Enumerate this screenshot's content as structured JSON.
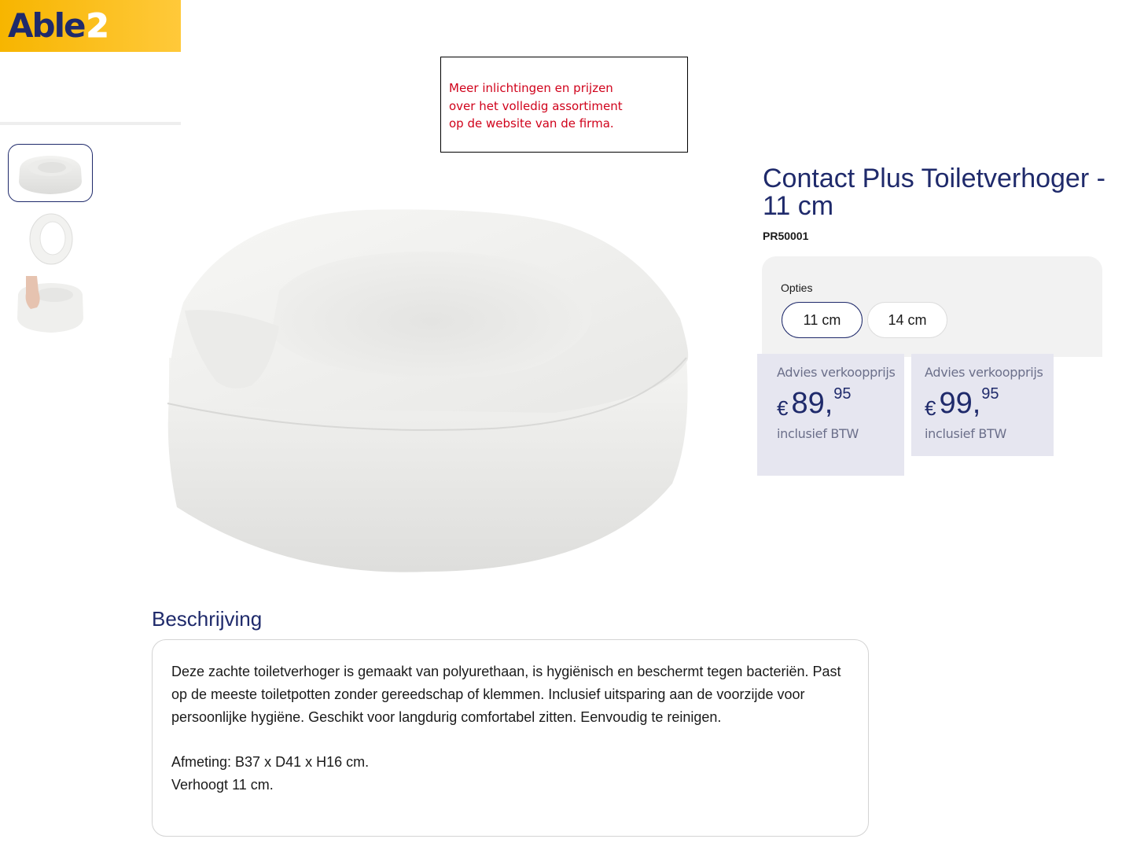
{
  "brand": {
    "logo_main": "Able",
    "logo_accent": "2"
  },
  "notice": {
    "lines": [
      "Meer inlichtingen en prijzen",
      "over het volledig assortiment",
      "op de website van de firma."
    ],
    "color": "#d0021b"
  },
  "gallery": {
    "thumbnails": [
      "toilet-seat-raiser-front",
      "toilet-seat-raiser-top",
      "toilet-seat-raiser-hand"
    ],
    "selected_index": 0
  },
  "product": {
    "title": "Contact Plus Toiletverhoger - 11 cm",
    "sku": "PR50001",
    "options_label": "Opties",
    "options": [
      "11 cm",
      "14 cm"
    ],
    "selected_option": "11 cm",
    "prices": [
      {
        "label": "Advies verkoopprijs",
        "currency": "€",
        "integer": "89,",
        "cents": "95",
        "note": "inclusief BTW"
      },
      {
        "label": "Advies verkoopprijs",
        "currency": "€",
        "integer": "99,",
        "cents": "95",
        "note": "inclusief BTW"
      }
    ]
  },
  "description": {
    "heading": "Beschrijving",
    "paragraph": "Deze zachte toiletverhoger is gemaakt van polyurethaan, is hygiënisch en beschermt tegen bacteriën. Past op de meeste toiletpotten zonder gereedschap of klemmen. Inclusief uitsparing aan de voorzijde voor persoonlijke hygiëne. Geschikt voor langdurig comfortabel zitten. Eenvoudig te reinigen.",
    "dimensions": "Afmeting: B37 x D41 x H16 cm.",
    "height_note": "Verhoogt 11 cm."
  },
  "colors": {
    "brand_navy": "#1f2a6b",
    "logo_yellow": "#ffc93a",
    "price_card_bg": "#e6e6f0",
    "options_bg": "#f2f2f2"
  }
}
